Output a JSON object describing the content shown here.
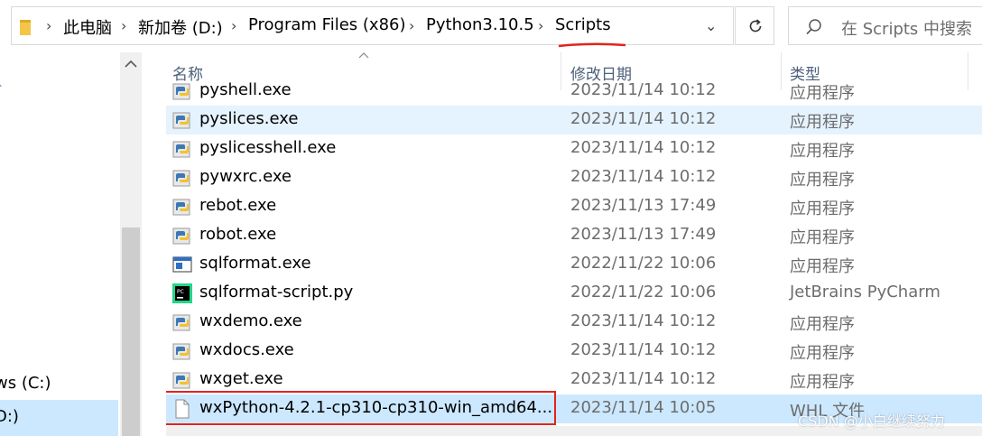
{
  "breadcrumb": [
    "此电脑",
    "新加卷 (D:)",
    "Program Files (x86)",
    "Python3.10.5",
    "Scripts"
  ],
  "search": {
    "placeholder": "在 Scripts 中搜索"
  },
  "nav": {
    "items": [
      "ws (C:)",
      "D:)"
    ]
  },
  "columns": {
    "name": "名称",
    "date": "修改日期",
    "type": "类型"
  },
  "files": [
    {
      "name": "pyshell.exe",
      "date": "2023/11/14 10:12",
      "type": "应用程序",
      "icon": "python-exe-icon"
    },
    {
      "name": "pyslices.exe",
      "date": "2023/11/14 10:12",
      "type": "应用程序",
      "icon": "python-exe-icon"
    },
    {
      "name": "pyslicesshell.exe",
      "date": "2023/11/14 10:12",
      "type": "应用程序",
      "icon": "python-exe-icon"
    },
    {
      "name": "pywxrc.exe",
      "date": "2023/11/14 10:12",
      "type": "应用程序",
      "icon": "python-exe-icon"
    },
    {
      "name": "rebot.exe",
      "date": "2023/11/13 17:49",
      "type": "应用程序",
      "icon": "python-exe-icon"
    },
    {
      "name": "robot.exe",
      "date": "2023/11/13 17:49",
      "type": "应用程序",
      "icon": "python-exe-icon"
    },
    {
      "name": "sqlformat.exe",
      "date": "2022/11/22 10:06",
      "type": "应用程序",
      "icon": "window-exe-icon"
    },
    {
      "name": "sqlformat-script.py",
      "date": "2022/11/22 10:06",
      "type": "JetBrains PyCharm",
      "icon": "pycharm-file-icon"
    },
    {
      "name": "wxdemo.exe",
      "date": "2023/11/14 10:12",
      "type": "应用程序",
      "icon": "python-exe-icon"
    },
    {
      "name": "wxdocs.exe",
      "date": "2023/11/14 10:12",
      "type": "应用程序",
      "icon": "python-exe-icon"
    },
    {
      "name": "wxget.exe",
      "date": "2023/11/14 10:12",
      "type": "应用程序",
      "icon": "python-exe-icon"
    },
    {
      "name": "wxPython-4.2.1-cp310-cp310-win_amd64....",
      "date": "2023/11/14 10:05",
      "type": "WHL 文件",
      "icon": "blank-file-icon"
    }
  ],
  "watermark": "CSDN @小白继续努力",
  "colors": {
    "selection": "#cce8ff",
    "hover": "#e5f3ff",
    "highlight": "#e0241f",
    "header_text": "#4c607a"
  }
}
